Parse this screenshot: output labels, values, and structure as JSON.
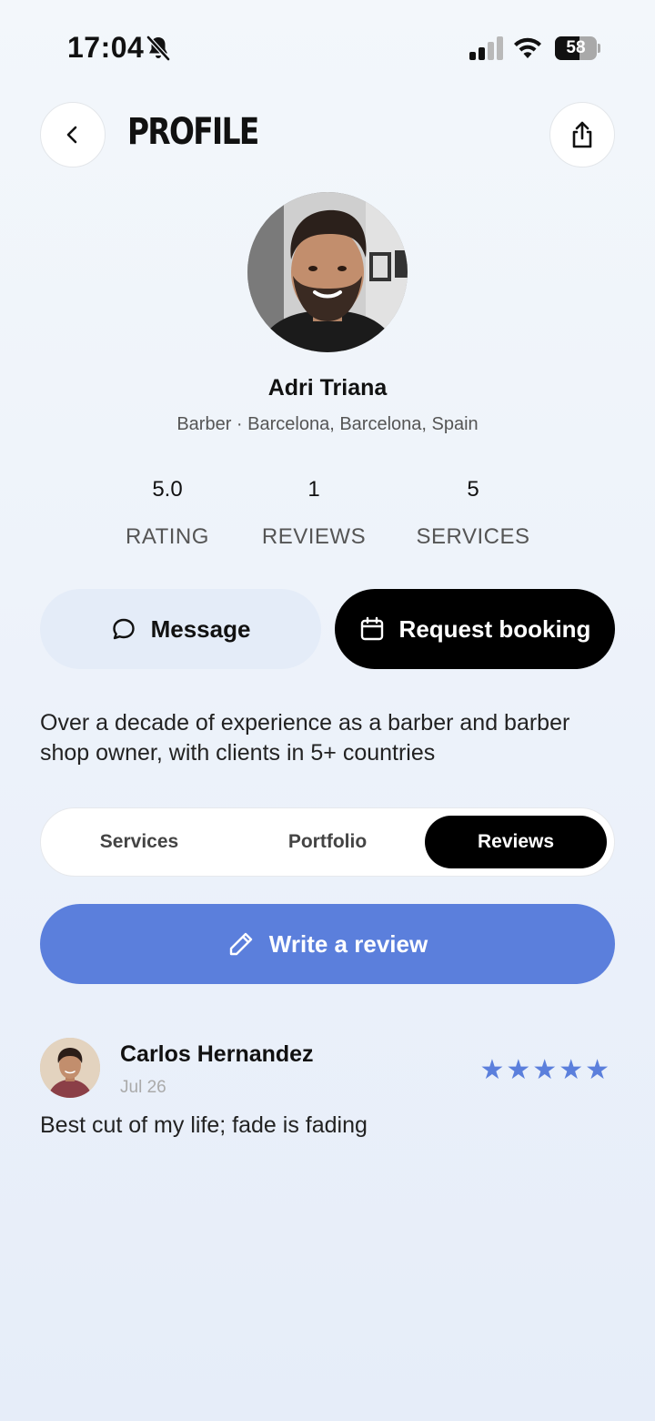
{
  "status_bar": {
    "time": "17:04",
    "battery_level": 58,
    "battery_label": "58",
    "icons": [
      "bell-slash-icon",
      "signal-icon",
      "wifi-icon",
      "battery-icon"
    ]
  },
  "header": {
    "title": "PROFILE",
    "back_icon": "chevron-left-icon",
    "share_icon": "share-icon"
  },
  "profile": {
    "name": "Adri Triana",
    "subtitle": "Barber · Barcelona, Barcelona, Spain",
    "stats": [
      {
        "value": "5.0",
        "label": "RATING"
      },
      {
        "value": "1",
        "label": "REVIEWS"
      },
      {
        "value": "5",
        "label": "SERVICES"
      }
    ],
    "bio": "Over a decade of experience as a barber and barber shop owner, with clients in 5+ countries"
  },
  "actions": {
    "message_label": "Message",
    "message_icon": "chat-bubble-icon",
    "booking_label": "Request booking",
    "booking_icon": "calendar-icon"
  },
  "tabs": [
    {
      "label": "Services",
      "active": false
    },
    {
      "label": "Portfolio",
      "active": false
    },
    {
      "label": "Reviews",
      "active": true
    }
  ],
  "write_review": {
    "label": "Write a review",
    "icon": "pencil-icon"
  },
  "reviews": [
    {
      "name": "Carlos Hernandez",
      "date": "Jul 26",
      "rating": 5,
      "stars": "★★★★★",
      "text": "Best cut of my life; fade is fading"
    }
  ],
  "colors": {
    "accent": "#5b7fdc",
    "primary_dark": "#000000",
    "message_bg": "#e4ecf8"
  }
}
